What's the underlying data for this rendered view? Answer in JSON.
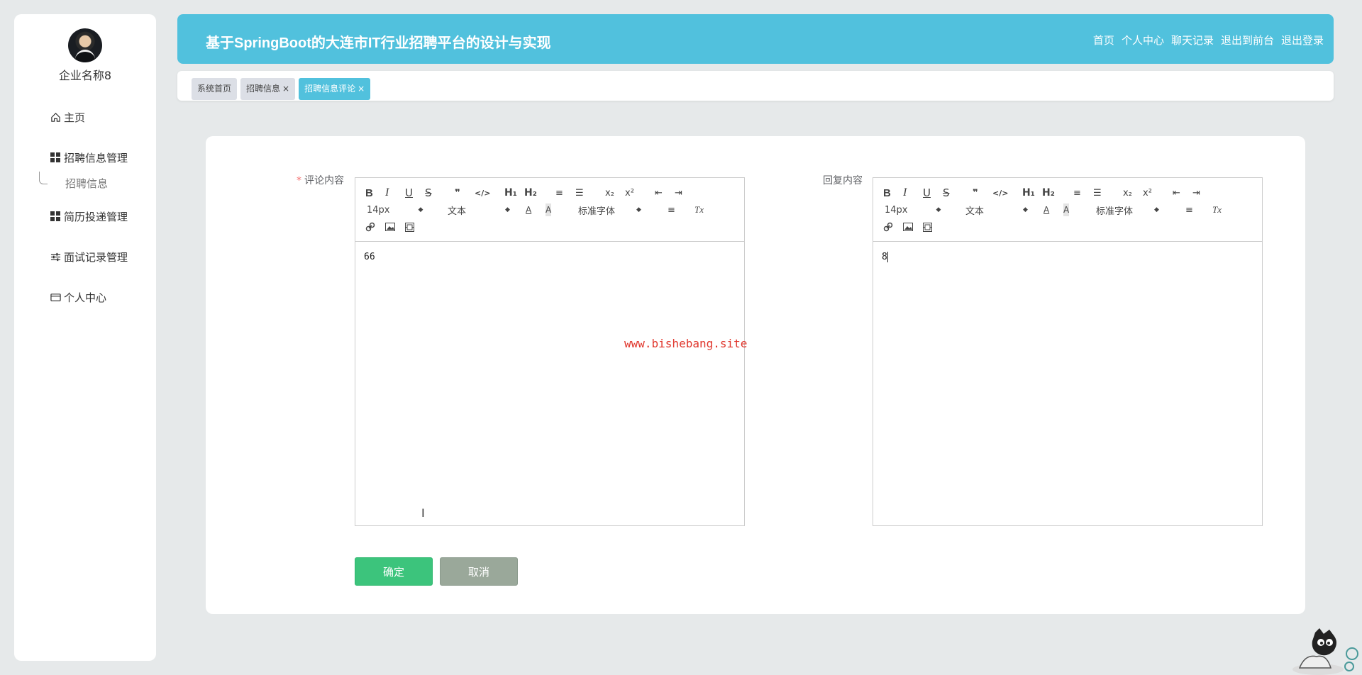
{
  "sidebar": {
    "company_name": "企业名称8",
    "items": [
      {
        "label": "主页",
        "icon": "home-icon"
      },
      {
        "label": "招聘信息管理",
        "icon": "grid-icon"
      },
      {
        "label": "招聘信息",
        "icon": ""
      },
      {
        "label": "简历投递管理",
        "icon": "grid-icon"
      },
      {
        "label": "面试记录管理",
        "icon": "sliders-icon"
      },
      {
        "label": "个人中心",
        "icon": "card-icon"
      }
    ]
  },
  "header": {
    "title": "基于SpringBoot的大连市IT行业招聘平台的设计与实现",
    "links": [
      "首页",
      "个人中心",
      "聊天记录",
      "退出到前台",
      "退出登录"
    ],
    "background": "#51c1dd"
  },
  "tabs": [
    {
      "label": "系统首页",
      "closable": false,
      "active": false
    },
    {
      "label": "招聘信息",
      "closable": true,
      "active": false
    },
    {
      "label": "招聘信息评论",
      "closable": true,
      "active": true
    }
  ],
  "tab_close_glyph": "×",
  "form": {
    "comment_label": "评论内容",
    "required_mark": "*",
    "comment_value": "66",
    "reply_label": "回复内容",
    "reply_value": "8",
    "toolbar": {
      "bold": "B",
      "italic": "I",
      "underline": "U",
      "strike": "S",
      "quote": "❞",
      "code": "</>",
      "h1": "H₁",
      "h2": "H₂",
      "ordered": "≡",
      "bullet": "☰",
      "sub": "x₂",
      "sup": "x²",
      "outdent": "⇤",
      "indent": "⇥",
      "size": "14px",
      "header": "文本",
      "color": "A",
      "bg": "A",
      "font": "标准字体",
      "align": "≡",
      "clean": "Tx"
    },
    "confirm_label": "确定",
    "cancel_label": "取消"
  },
  "watermark": "www.bishebang.site",
  "colors": {
    "accent": "#51c1dd",
    "confirm": "#3cc47c",
    "cancel": "#9aa89a",
    "required": "#f56c6c",
    "watermark": "#e0352b"
  }
}
